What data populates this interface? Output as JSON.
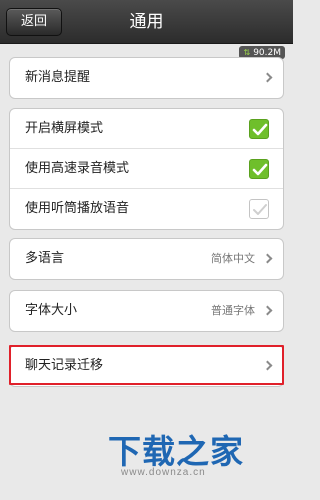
{
  "header": {
    "back_label": "返回",
    "title": "通用"
  },
  "status": {
    "network_speed": "90.2M"
  },
  "groups": [
    {
      "items": [
        {
          "label": "新消息提醒"
        }
      ]
    },
    {
      "items": [
        {
          "label": "开启横屏模式",
          "checked": true
        },
        {
          "label": "使用高速录音模式",
          "checked": true
        },
        {
          "label": "使用听筒播放语音",
          "checked": false
        }
      ]
    },
    {
      "items": [
        {
          "label": "多语言",
          "value": "简体中文"
        }
      ]
    },
    {
      "items": [
        {
          "label": "字体大小",
          "value": "普通字体"
        }
      ]
    },
    {
      "items": [
        {
          "label": "聊天记录迁移"
        }
      ]
    }
  ],
  "watermark": {
    "logo": "下载之家",
    "url": "www.downza.cn"
  },
  "colors": {
    "check_on": "#6fbf2b",
    "highlight": "#e0202a",
    "brand": "#1f67b3"
  }
}
